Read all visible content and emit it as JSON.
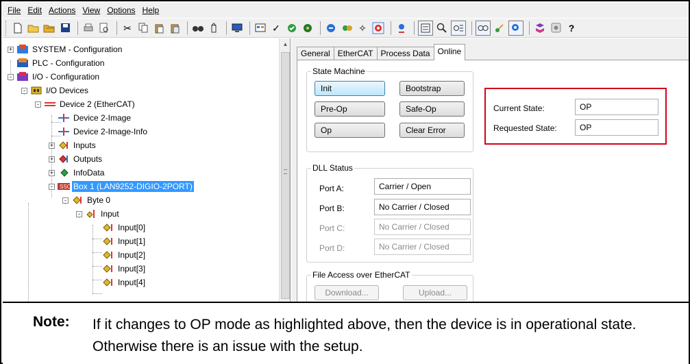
{
  "menubar": {
    "items": [
      {
        "label": "File"
      },
      {
        "label": "Edit"
      },
      {
        "label": "Actions"
      },
      {
        "label": "View"
      },
      {
        "label": "Options"
      },
      {
        "label": "Help"
      }
    ]
  },
  "toolbar": {
    "icons": [
      "new-file-icon",
      "open-folder-icon",
      "open-project-icon",
      "save-icon",
      "print-icon",
      "print-preview-icon",
      "cut-icon",
      "copy-icon",
      "paste-icon",
      "paste-with-links-icon",
      "find-icon",
      "replace-icon",
      "target-system-icon",
      "build-icon",
      "check-configuration-icon",
      "activate-configuration-icon",
      "set-run-mode-icon",
      "restart-icon",
      "reload-devices-icon",
      "scan-devices-icon",
      "toggle-freerun-icon",
      "show-online-data-icon",
      "show-sub-items-icon",
      "zoom-icon",
      "autoscale-icon",
      "watch-icon",
      "show-variables-icon",
      "select-target-icon",
      "library-icon",
      "settings-icon",
      "help-icon"
    ]
  },
  "tree": {
    "nodes": [
      {
        "label": "SYSTEM - Configuration",
        "icon": "system-config-icon",
        "expander": "+"
      },
      {
        "label": "PLC - Configuration",
        "icon": "plc-config-icon",
        "expander": ""
      },
      {
        "label": "I/O - Configuration",
        "icon": "io-config-icon",
        "expander": "-"
      },
      {
        "label": "I/O Devices",
        "icon": "io-devices-icon",
        "expander": "-"
      },
      {
        "label": "Device 2 (EtherCAT)",
        "icon": "ethercat-device-icon",
        "expander": "-"
      },
      {
        "label": "Device 2-Image",
        "icon": "device-image-icon",
        "expander": ""
      },
      {
        "label": "Device 2-Image-Info",
        "icon": "device-image-info-icon",
        "expander": ""
      },
      {
        "label": "Inputs",
        "icon": "inputs-icon",
        "expander": "+"
      },
      {
        "label": "Outputs",
        "icon": "outputs-icon",
        "expander": "+"
      },
      {
        "label": "InfoData",
        "icon": "infodata-icon",
        "expander": "+"
      },
      {
        "label": "Box 1 (LAN9252-DIGIO-2PORT)",
        "icon": "box-icon",
        "expander": "-"
      },
      {
        "label": "Byte 0",
        "icon": "byte-icon",
        "expander": "-"
      },
      {
        "label": "Input",
        "icon": "input-group-icon",
        "expander": "-"
      },
      {
        "label": "Input[0]",
        "icon": "input-variable-icon",
        "expander": ""
      },
      {
        "label": "Input[1]",
        "icon": "input-variable-icon",
        "expander": ""
      },
      {
        "label": "Input[2]",
        "icon": "input-variable-icon",
        "expander": ""
      },
      {
        "label": "Input[3]",
        "icon": "input-variable-icon",
        "expander": ""
      },
      {
        "label": "Input[4]",
        "icon": "input-variable-icon",
        "expander": ""
      }
    ]
  },
  "tabs": [
    {
      "label": "General"
    },
    {
      "label": "EtherCAT"
    },
    {
      "label": "Process Data"
    },
    {
      "label": "Online"
    }
  ],
  "state_machine": {
    "title": "State Machine",
    "init": "Init",
    "bootstrap": "Bootstrap",
    "preop": "Pre-Op",
    "safeop": "Safe-Op",
    "op": "Op",
    "clear_error": "Clear Error",
    "current_state_label": "Current State:",
    "current_state_value": "OP",
    "requested_state_label": "Requested State:",
    "requested_state_value": "OP"
  },
  "dll_status": {
    "title": "DLL Status",
    "ports": [
      {
        "label": "Port A:",
        "value": "Carrier / Open"
      },
      {
        "label": "Port B:",
        "value": "No Carrier / Closed"
      },
      {
        "label": "Port C:",
        "value": "No Carrier / Closed"
      },
      {
        "label": "Port D:",
        "value": "No Carrier / Closed"
      }
    ]
  },
  "file_access": {
    "title": "File Access over EtherCAT",
    "download": "Download...",
    "upload": "Upload..."
  },
  "note": {
    "label": "Note:",
    "text": "If it changes to OP mode as highlighted above, then the device is in operational state. Otherwise there is an issue with the setup."
  },
  "colors": {
    "highlight": "#d0021b",
    "selection": "#3399ff"
  }
}
